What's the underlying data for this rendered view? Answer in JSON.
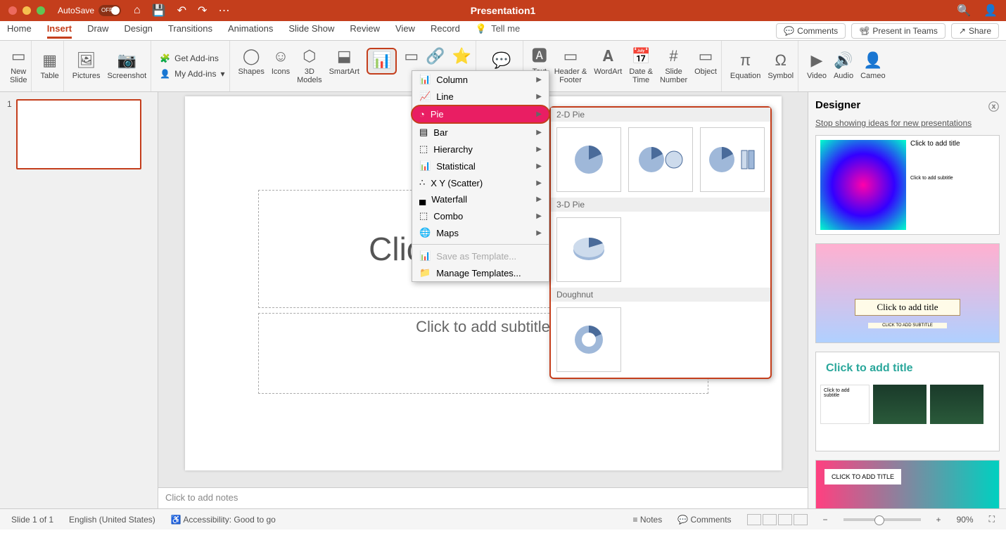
{
  "titlebar": {
    "autosave_label": "AutoSave",
    "autosave_state": "OFF",
    "doc_title": "Presentation1"
  },
  "tabs": [
    "Home",
    "Insert",
    "Draw",
    "Design",
    "Transitions",
    "Animations",
    "Slide Show",
    "Review",
    "View",
    "Record"
  ],
  "active_tab": "Insert",
  "tellme": "Tell me",
  "actions": {
    "comments": "Comments",
    "present": "Present in Teams",
    "share": "Share"
  },
  "ribbon": {
    "new_slide": "New\nSlide",
    "table": "Table",
    "pictures": "Pictures",
    "screenshot": "Screenshot",
    "get_addins": "Get Add-ins",
    "my_addins": "My Add-ins",
    "shapes": "Shapes",
    "icons": "Icons",
    "models": "3D\nModels",
    "smartart": "SmartArt",
    "comment": "Comment",
    "textbox": "Text\nBox",
    "header": "Header &\nFooter",
    "wordart": "WordArt",
    "datetime": "Date &\nTime",
    "slidenum": "Slide\nNumber",
    "object": "Object",
    "equation": "Equation",
    "symbol": "Symbol",
    "video": "Video",
    "audio": "Audio",
    "cameo": "Cameo"
  },
  "dropdown": {
    "items": [
      {
        "label": "Column"
      },
      {
        "label": "Line"
      },
      {
        "label": "Pie",
        "highlight": true
      },
      {
        "label": "Bar"
      },
      {
        "label": "Hierarchy"
      },
      {
        "label": "Statistical"
      },
      {
        "label": "X Y (Scatter)"
      },
      {
        "label": "Waterfall"
      },
      {
        "label": "Combo"
      },
      {
        "label": "Maps"
      }
    ],
    "save_tpl": "Save as Template...",
    "manage_tpl": "Manage Templates..."
  },
  "submenu": {
    "h2d": "2-D Pie",
    "h3d": "3-D Pie",
    "hdough": "Doughnut"
  },
  "slide": {
    "title_ph": "Click to add title",
    "sub_ph": "Click to add subtitle",
    "num": "1"
  },
  "designer": {
    "title": "Designer",
    "link": "Stop showing ideas for new presentations",
    "card_title": "Click to add title",
    "card_sub": "Click to add subtitle",
    "card2_title": "Click to add title",
    "card2_sub": "CLICK TO ADD SUBTITLE",
    "card3_title": "Click to add title",
    "card3_sub": "Click to add subtitle",
    "card4_title": "CLICK TO ADD TITLE"
  },
  "notes": "Click to add notes",
  "status": {
    "slide": "Slide 1 of 1",
    "lang": "English (United States)",
    "access": "Accessibility: Good to go",
    "notes": "Notes",
    "comments": "Comments",
    "zoom": "90%"
  }
}
